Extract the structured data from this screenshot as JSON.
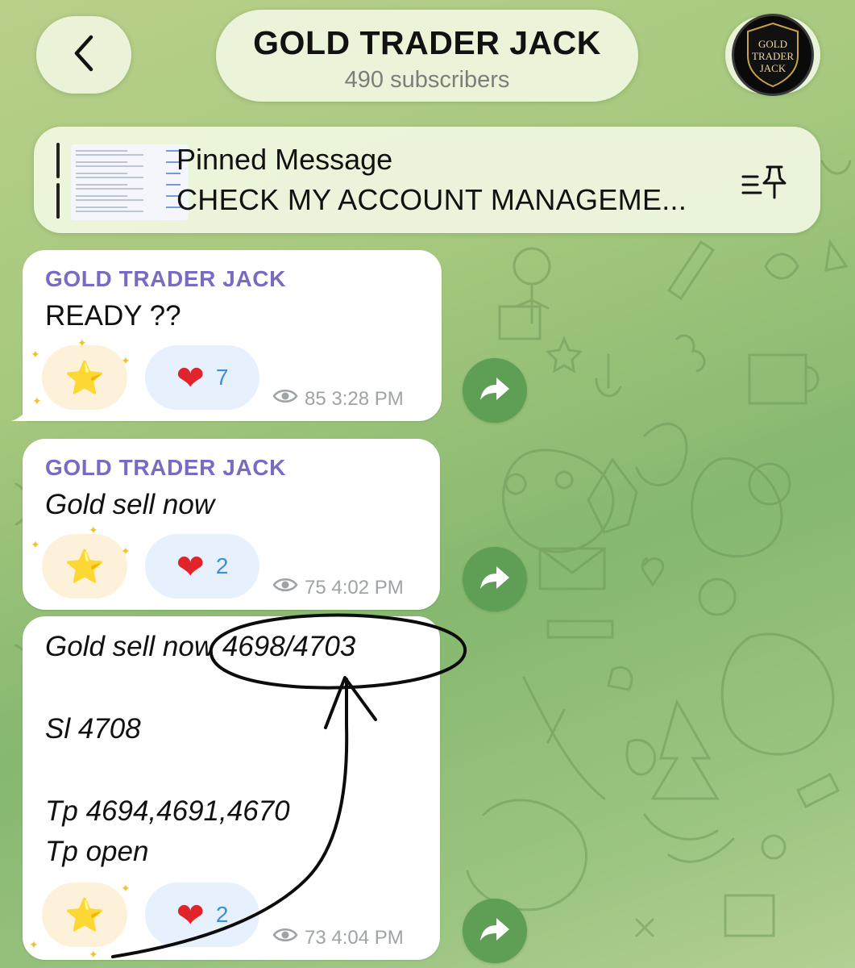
{
  "header": {
    "back_icon": "chevron-left-icon",
    "channel_name": "GOLD TRADER JACK",
    "subscribers": "490 subscribers",
    "avatar_lines": [
      "GOLD",
      "TRADER",
      "JACK"
    ]
  },
  "pinned": {
    "title": "Pinned Message",
    "text": "CHECK MY ACCOUNT MANAGEME...",
    "icon": "pinned-list-icon"
  },
  "messages": [
    {
      "sender": "GOLD TRADER JACK",
      "lines": [
        "READY ??"
      ],
      "reaction_star": "⭐",
      "reaction_heart": "❤",
      "heart_count": "7",
      "views": "85",
      "time": "3:28 PM"
    },
    {
      "sender": "GOLD TRADER JACK",
      "lines": [
        "Gold sell now"
      ],
      "reaction_star": "⭐",
      "reaction_heart": "❤",
      "heart_count": "2",
      "views": "75",
      "time": "4:02 PM"
    },
    {
      "sender": "",
      "lines": [
        "Gold sell now 4698/4703",
        "Sl 4708",
        "Tp 4694,4691,4670",
        "Tp open"
      ],
      "reaction_star": "⭐",
      "reaction_heart": "❤",
      "heart_count": "2",
      "views": "73",
      "time": "4:04 PM"
    }
  ],
  "colors": {
    "sender": "#7b6ac2",
    "heart_count": "#3c8ddf",
    "share_button": "#5e9e55",
    "background": "#9cc582"
  }
}
